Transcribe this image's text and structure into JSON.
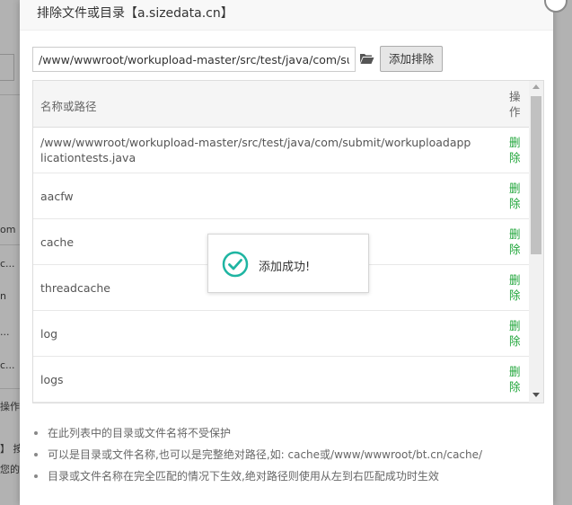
{
  "dialog": {
    "title": "排除文件或目录【a.sizedata.cn】",
    "path_input_value": "/www/wwwroot/workupload-master/src/test/java/com/submit/workuploadapplicationtests.java",
    "folder_icon": "folder-open-icon",
    "add_button_label": "添加排除",
    "close_icon": "close-icon"
  },
  "table": {
    "headers": {
      "name": "名称或路径",
      "operation": "操作"
    },
    "rows": [
      {
        "name": "/www/wwwroot/workupload-master/src/test/java/com/submit/workuploadapplicationtests.java",
        "action": "删除"
      },
      {
        "name": "aacfw",
        "action": "删除"
      },
      {
        "name": "cache",
        "action": "删除"
      },
      {
        "name": "threadcache",
        "action": "删除"
      },
      {
        "name": "log",
        "action": "删除"
      },
      {
        "name": "logs",
        "action": "删除"
      }
    ]
  },
  "toast": {
    "icon": "check-circle-icon",
    "message": "添加成功!"
  },
  "tips": [
    "在此列表中的目录或文件名将不受保护",
    "可以是目录或文件名称,也可以是完整绝对路径,如: cache或/www/wwwroot/bt.cn/cache/",
    "目录或文件名称在完全匹配的情况下生效,绝对路径则使用从左到右匹配成功时生效"
  ],
  "background": {
    "fragments": [
      "om",
      "c...",
      "n",
      "...",
      "c...",
      "操作",
      "】 按",
      "您的"
    ]
  },
  "colors": {
    "accent": "#20a53a",
    "toast_icon": "#1fb5a2"
  }
}
